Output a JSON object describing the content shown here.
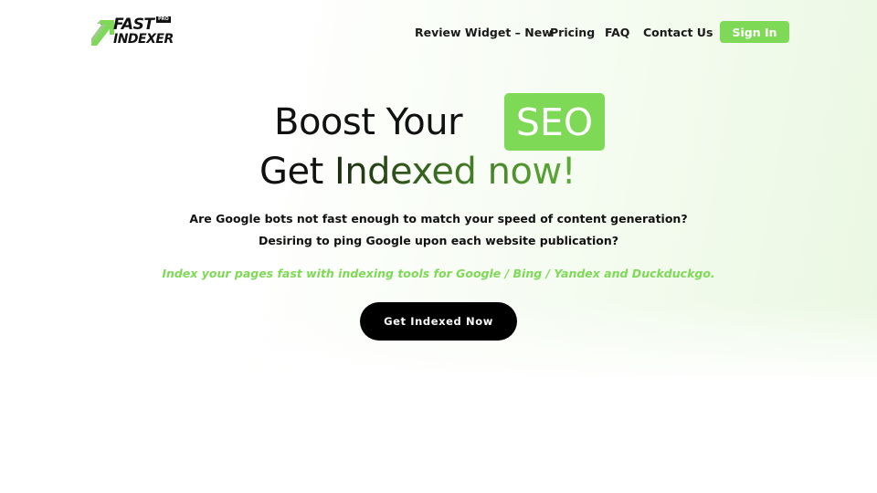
{
  "logo": {
    "line1": "FAST",
    "line2": "INDEXER",
    "badge": "PRO",
    "icon": "arrow-up-right-icon"
  },
  "nav": {
    "items": [
      {
        "label": "Review Widget – New"
      },
      {
        "label": "Pricing"
      },
      {
        "label": "FAQ"
      },
      {
        "label": "Contact Us"
      }
    ],
    "signin_label": "Sign In"
  },
  "hero": {
    "line1_text": "Boost Your",
    "line1_badge": "SEO",
    "line2_plain": "Get ",
    "line2_highlight": "Indexed now!",
    "subtitle_line1": "Are Google bots not fast enough to match your speed of content generation?",
    "subtitle_line2": "Desiring to ping Google upon each website publication?",
    "tagline": "Index your pages fast with indexing tools for Google / Bing / Yandex and Duckduckgo.",
    "cta_label": "Get Indexed Now"
  },
  "colors": {
    "accent": "#7ed957",
    "text": "#111111",
    "cta_background": "#000000",
    "heading_gradient_start": "#1a2a0e",
    "heading_gradient_end": "#5fae3a"
  }
}
